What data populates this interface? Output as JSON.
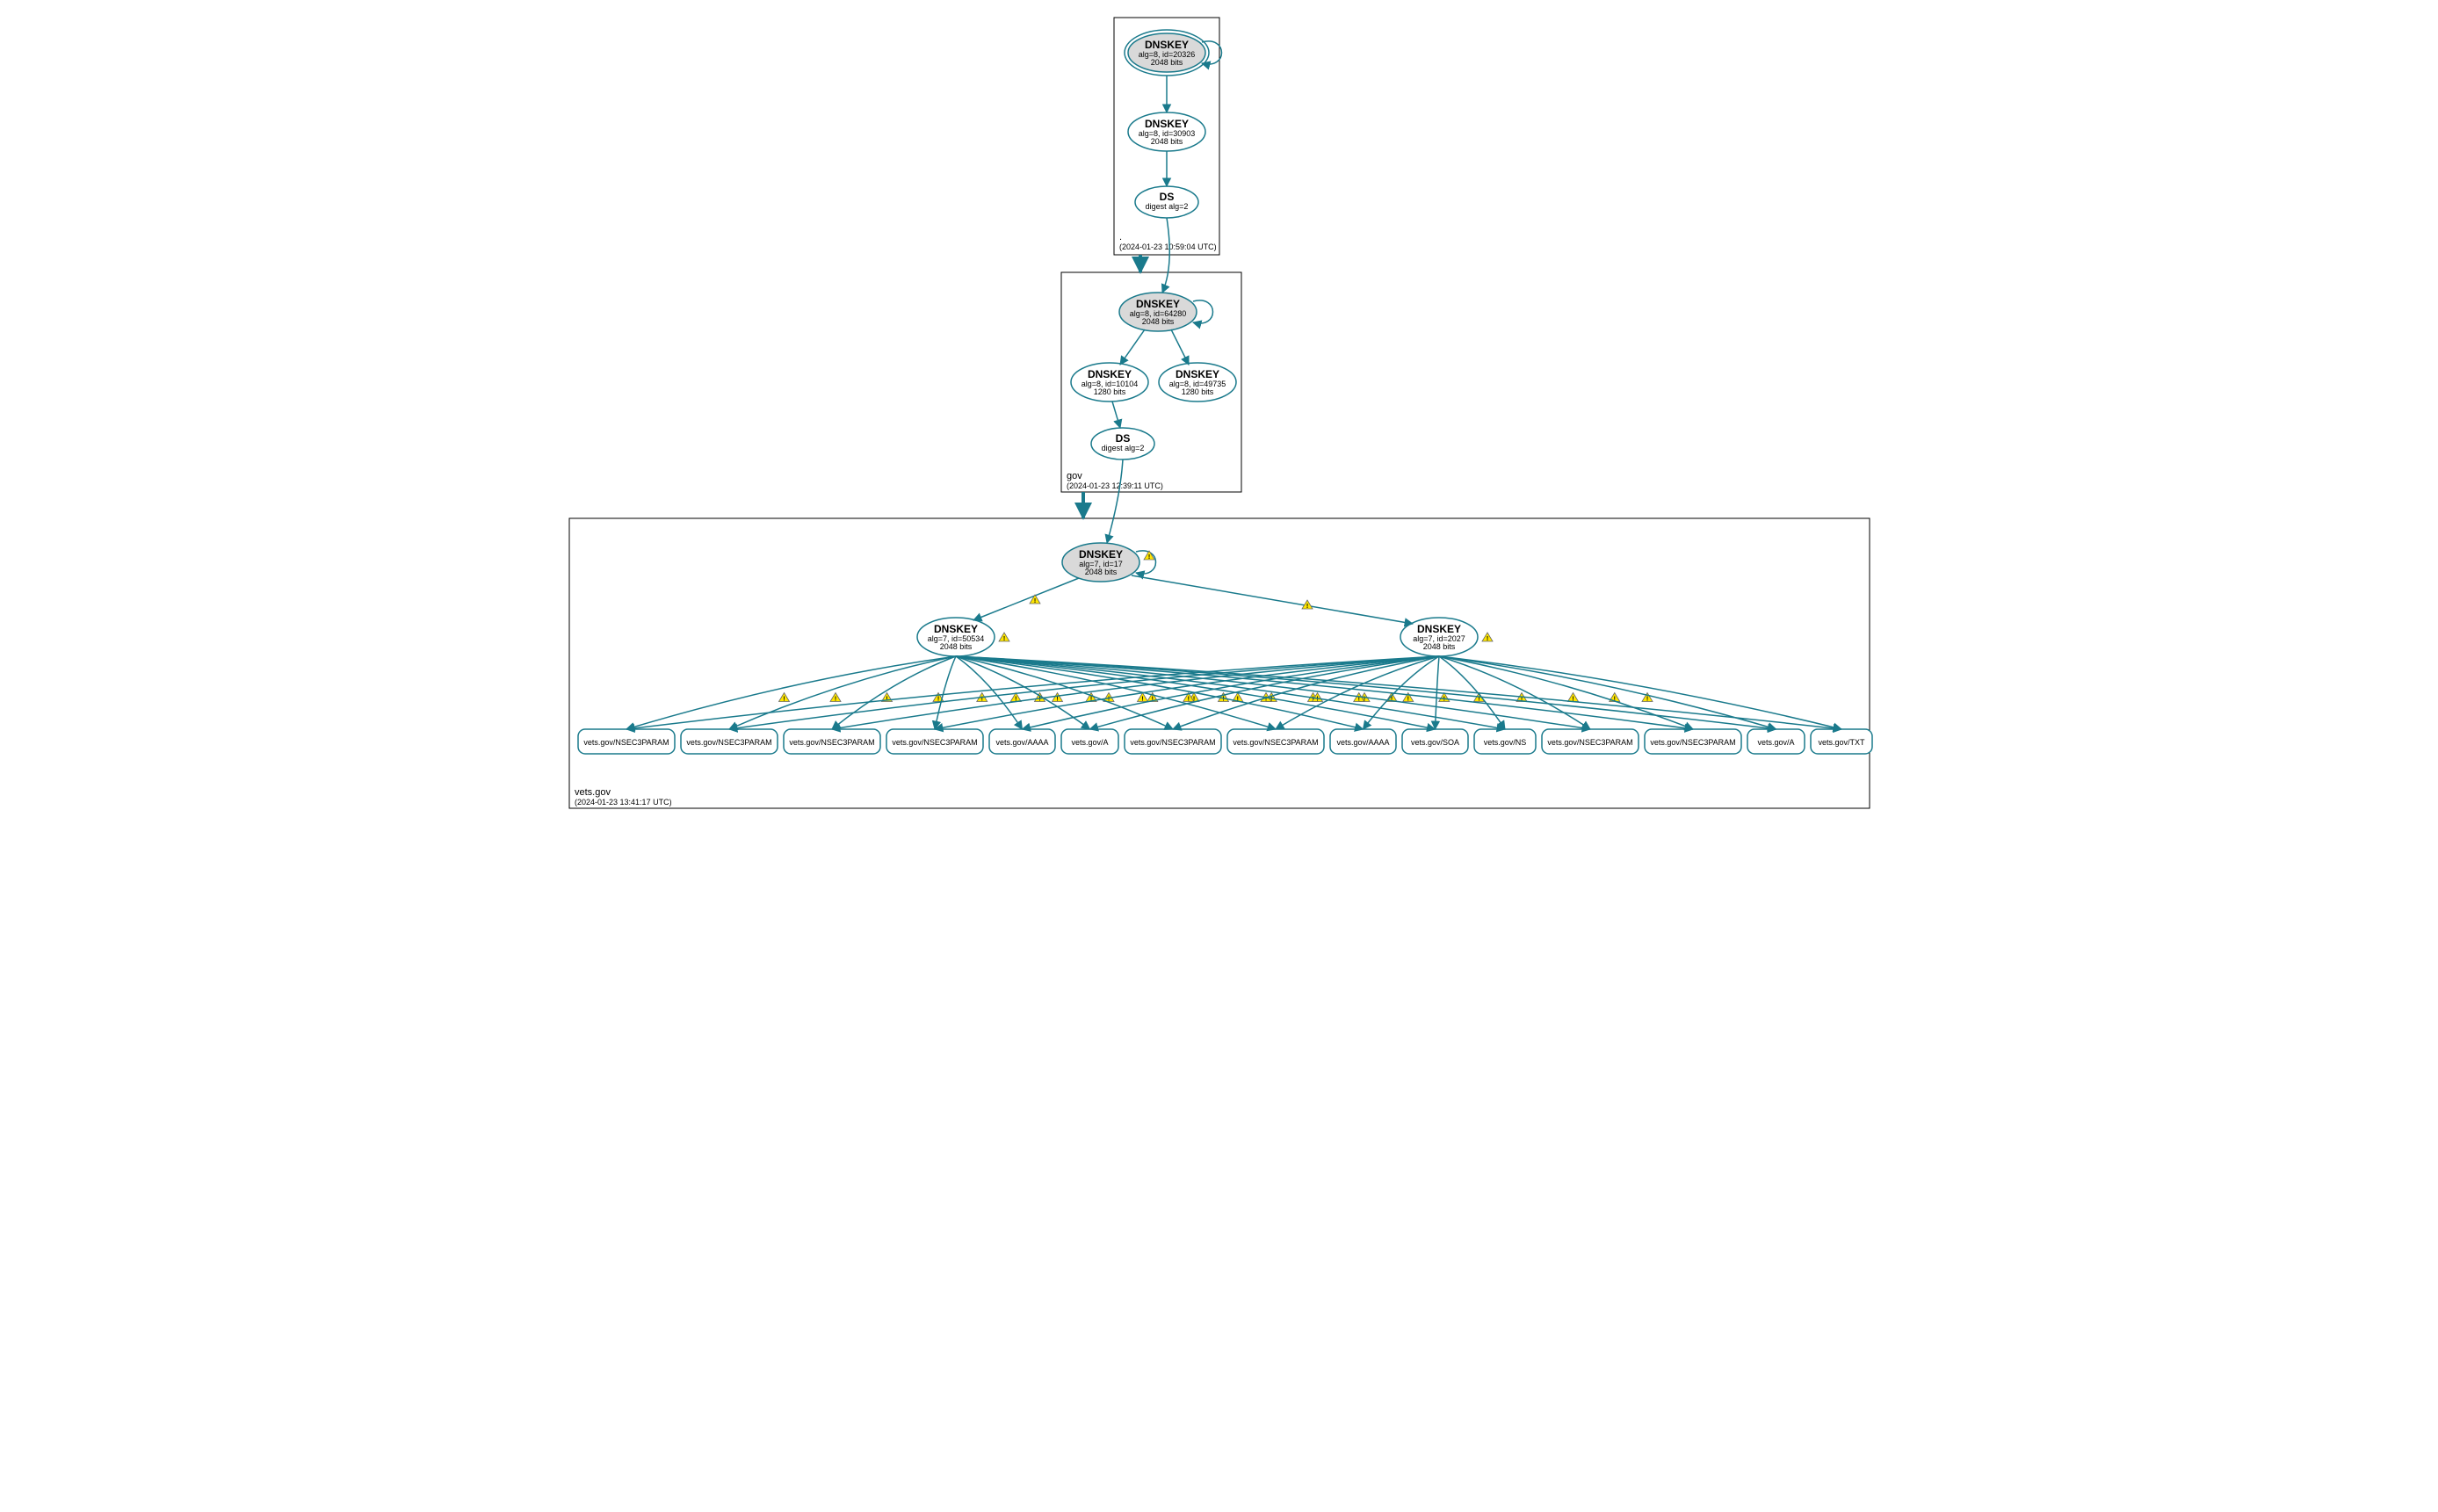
{
  "zones": {
    "root": {
      "label": ".",
      "time": "(2024-01-23 10:59:04 UTC)"
    },
    "gov": {
      "label": "gov",
      "time": "(2024-01-23 12:39:11 UTC)"
    },
    "vets": {
      "label": "vets.gov",
      "time": "(2024-01-23 13:41:17 UTC)"
    }
  },
  "nodes": {
    "root_ksk": {
      "title": "DNSKEY",
      "l1": "alg=8, id=20326",
      "l2": "2048 bits"
    },
    "root_zsk": {
      "title": "DNSKEY",
      "l1": "alg=8, id=30903",
      "l2": "2048 bits"
    },
    "root_ds": {
      "title": "DS",
      "l1": "digest alg=2",
      "l2": ""
    },
    "gov_ksk": {
      "title": "DNSKEY",
      "l1": "alg=8, id=64280",
      "l2": "2048 bits"
    },
    "gov_zsk1": {
      "title": "DNSKEY",
      "l1": "alg=8, id=10104",
      "l2": "1280 bits"
    },
    "gov_zsk2": {
      "title": "DNSKEY",
      "l1": "alg=8, id=49735",
      "l2": "1280 bits"
    },
    "gov_ds": {
      "title": "DS",
      "l1": "digest alg=2",
      "l2": ""
    },
    "vets_ksk": {
      "title": "DNSKEY",
      "l1": "alg=7, id=17",
      "l2": "2048 bits"
    },
    "vets_zsk1": {
      "title": "DNSKEY",
      "l1": "alg=7, id=50534",
      "l2": "2048 bits"
    },
    "vets_zsk2": {
      "title": "DNSKEY",
      "l1": "alg=7, id=2027",
      "l2": "2048 bits"
    }
  },
  "leaves": {
    "r0": "vets.gov/NSEC3PARAM",
    "r1": "vets.gov/NSEC3PARAM",
    "r2": "vets.gov/NSEC3PARAM",
    "r3": "vets.gov/NSEC3PARAM",
    "r4": "vets.gov/AAAA",
    "r5": "vets.gov/A",
    "r6": "vets.gov/NSEC3PARAM",
    "r7": "vets.gov/NSEC3PARAM",
    "r8": "vets.gov/AAAA",
    "r9": "vets.gov/SOA",
    "r10": "vets.gov/NS",
    "r11": "vets.gov/NSEC3PARAM",
    "r12": "vets.gov/NSEC3PARAM",
    "r13": "vets.gov/A",
    "r14": "vets.gov/TXT"
  },
  "chart_data": {
    "type": "dnssec-authentication-graph",
    "zones": [
      {
        "name": ".",
        "timestamp": "2024-01-23 10:59:04 UTC",
        "nodes": [
          {
            "id": "root_ksk",
            "kind": "DNSKEY",
            "alg": 8,
            "keyid": 20326,
            "bits": 2048,
            "role": "KSK",
            "trust_anchor": true
          },
          {
            "id": "root_zsk",
            "kind": "DNSKEY",
            "alg": 8,
            "keyid": 30903,
            "bits": 2048,
            "role": "ZSK"
          },
          {
            "id": "root_ds",
            "kind": "DS",
            "digest_alg": 2
          }
        ],
        "edges": [
          {
            "from": "root_ksk",
            "to": "root_ksk",
            "self": true
          },
          {
            "from": "root_ksk",
            "to": "root_zsk"
          },
          {
            "from": "root_zsk",
            "to": "root_ds"
          }
        ]
      },
      {
        "name": "gov",
        "timestamp": "2024-01-23 12:39:11 UTC",
        "nodes": [
          {
            "id": "gov_ksk",
            "kind": "DNSKEY",
            "alg": 8,
            "keyid": 64280,
            "bits": 2048,
            "role": "KSK"
          },
          {
            "id": "gov_zsk1",
            "kind": "DNSKEY",
            "alg": 8,
            "keyid": 10104,
            "bits": 1280,
            "role": "ZSK"
          },
          {
            "id": "gov_zsk2",
            "kind": "DNSKEY",
            "alg": 8,
            "keyid": 49735,
            "bits": 1280,
            "role": "ZSK"
          },
          {
            "id": "gov_ds",
            "kind": "DS",
            "digest_alg": 2
          }
        ],
        "edges": [
          {
            "from": "root_ds",
            "to": "gov_ksk",
            "delegation": true
          },
          {
            "from": "gov_ksk",
            "to": "gov_ksk",
            "self": true
          },
          {
            "from": "gov_ksk",
            "to": "gov_zsk1"
          },
          {
            "from": "gov_ksk",
            "to": "gov_zsk2"
          },
          {
            "from": "gov_zsk1",
            "to": "gov_ds"
          }
        ]
      },
      {
        "name": "vets.gov",
        "timestamp": "2024-01-23 13:41:17 UTC",
        "nodes": [
          {
            "id": "vets_ksk",
            "kind": "DNSKEY",
            "alg": 7,
            "keyid": 17,
            "bits": 2048,
            "role": "KSK",
            "warning": true
          },
          {
            "id": "vets_zsk1",
            "kind": "DNSKEY",
            "alg": 7,
            "keyid": 50534,
            "bits": 2048,
            "role": "ZSK",
            "warning": true
          },
          {
            "id": "vets_zsk2",
            "kind": "DNSKEY",
            "alg": 7,
            "keyid": 2027,
            "bits": 2048,
            "role": "ZSK",
            "warning": true
          }
        ],
        "rrsets": [
          {
            "name": "vets.gov",
            "type": "NSEC3PARAM",
            "signed_by": [
              "vets_zsk1",
              "vets_zsk2"
            ],
            "warning": true
          },
          {
            "name": "vets.gov",
            "type": "NSEC3PARAM",
            "signed_by": [
              "vets_zsk1",
              "vets_zsk2"
            ],
            "warning": true
          },
          {
            "name": "vets.gov",
            "type": "NSEC3PARAM",
            "signed_by": [
              "vets_zsk1",
              "vets_zsk2"
            ],
            "warning": true
          },
          {
            "name": "vets.gov",
            "type": "NSEC3PARAM",
            "signed_by": [
              "vets_zsk1",
              "vets_zsk2"
            ],
            "warning": true
          },
          {
            "name": "vets.gov",
            "type": "AAAA",
            "signed_by": [
              "vets_zsk1",
              "vets_zsk2"
            ],
            "warning": true
          },
          {
            "name": "vets.gov",
            "type": "A",
            "signed_by": [
              "vets_zsk1",
              "vets_zsk2"
            ],
            "warning": true
          },
          {
            "name": "vets.gov",
            "type": "NSEC3PARAM",
            "signed_by": [
              "vets_zsk1",
              "vets_zsk2"
            ],
            "warning": true
          },
          {
            "name": "vets.gov",
            "type": "NSEC3PARAM",
            "signed_by": [
              "vets_zsk1",
              "vets_zsk2"
            ],
            "warning": true
          },
          {
            "name": "vets.gov",
            "type": "AAAA",
            "signed_by": [
              "vets_zsk1",
              "vets_zsk2"
            ],
            "warning": true
          },
          {
            "name": "vets.gov",
            "type": "SOA",
            "signed_by": [
              "vets_zsk1",
              "vets_zsk2"
            ],
            "warning": true
          },
          {
            "name": "vets.gov",
            "type": "NS",
            "signed_by": [
              "vets_zsk1",
              "vets_zsk2"
            ],
            "warning": true
          },
          {
            "name": "vets.gov",
            "type": "NSEC3PARAM",
            "signed_by": [
              "vets_zsk1",
              "vets_zsk2"
            ],
            "warning": true
          },
          {
            "name": "vets.gov",
            "type": "NSEC3PARAM",
            "signed_by": [
              "vets_zsk1",
              "vets_zsk2"
            ],
            "warning": true
          },
          {
            "name": "vets.gov",
            "type": "A",
            "signed_by": [
              "vets_zsk1",
              "vets_zsk2"
            ],
            "warning": true
          },
          {
            "name": "vets.gov",
            "type": "TXT",
            "signed_by": [
              "vets_zsk1",
              "vets_zsk2"
            ],
            "warning": true
          }
        ],
        "edges": [
          {
            "from": "gov_ds",
            "to": "vets_ksk",
            "delegation": true
          },
          {
            "from": "vets_ksk",
            "to": "vets_ksk",
            "self": true,
            "warning": true
          },
          {
            "from": "vets_ksk",
            "to": "vets_zsk1",
            "warning": true
          },
          {
            "from": "vets_ksk",
            "to": "vets_zsk2",
            "warning": true
          }
        ]
      }
    ]
  }
}
